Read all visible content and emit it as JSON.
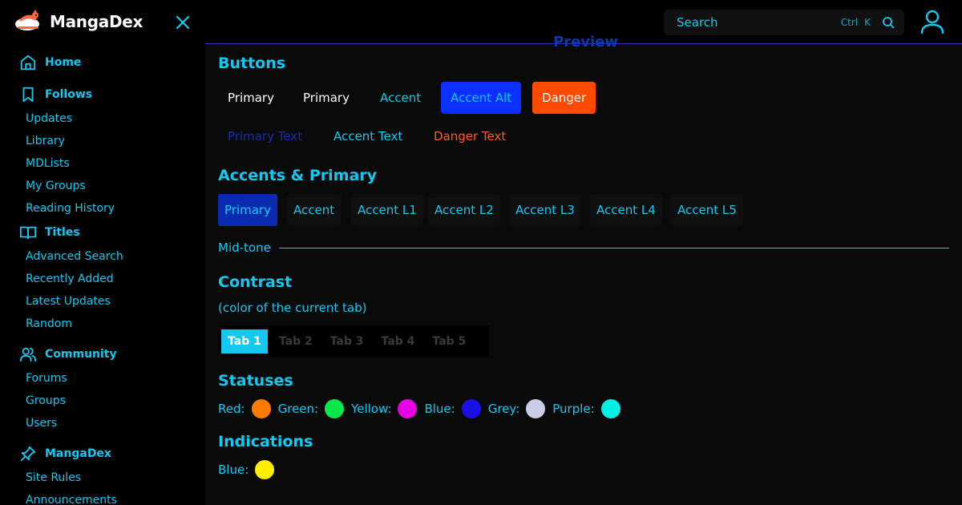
{
  "app": {
    "name": "MangaDex"
  },
  "topbar": {
    "search_placeholder": "Search",
    "shortcut_ctrl": "Ctrl",
    "shortcut_key": "K"
  },
  "sidebar": {
    "sections": [
      {
        "label": "Home",
        "icon": "home-icon",
        "items": []
      },
      {
        "label": "Follows",
        "icon": "bookmark-icon",
        "items": [
          "Updates",
          "Library",
          "MDLists",
          "My Groups",
          "Reading History"
        ]
      },
      {
        "label": "Titles",
        "icon": "book-icon",
        "items": [
          "Advanced Search",
          "Recently Added",
          "Latest Updates",
          "Random"
        ]
      },
      {
        "label": "Community",
        "icon": "users-icon",
        "items": [
          "Forums",
          "Groups",
          "Users"
        ]
      },
      {
        "label": "MangaDex",
        "icon": "pin-icon",
        "items": [
          "Site Rules",
          "Announcements"
        ]
      }
    ]
  },
  "main": {
    "peek_heading": "Preview",
    "buttons_heading": "Buttons",
    "buttons": [
      "Primary",
      "Primary",
      "Accent",
      "Accent Alt",
      "Danger"
    ],
    "text_buttons": [
      "Primary Text",
      "Accent Text",
      "Danger Text"
    ],
    "accents_heading": "Accents & Primary",
    "accent_tiles": [
      "Primary",
      "Accent",
      "Accent L1",
      "Accent L2",
      "Accent L3",
      "Accent L4",
      "Accent L5"
    ],
    "midtone_label": "Mid-tone",
    "contrast_heading": "Contrast",
    "contrast_sub": "(color of the current tab)",
    "tabs": [
      "Tab 1",
      "Tab 2",
      "Tab 3",
      "Tab 4",
      "Tab 5"
    ],
    "statuses_heading": "Statuses",
    "statuses": [
      {
        "label": "Red:",
        "color": "#ff7b00"
      },
      {
        "label": "Green:",
        "color": "#08e84a"
      },
      {
        "label": "Yellow:",
        "color": "#e600e6"
      },
      {
        "label": "Blue:",
        "color": "#1a10e6"
      },
      {
        "label": "Grey:",
        "color": "#c9cde6"
      },
      {
        "label": "Purple:",
        "color": "#00f0e6"
      }
    ],
    "indications_heading": "Indications",
    "indications": [
      {
        "label": "Blue:",
        "color": "#ffee00"
      }
    ]
  },
  "colors": {
    "accent": "#14c8f0",
    "primary": "#0a2ab0",
    "accent_alt": "#0b2fff",
    "danger": "#ff4a00",
    "primary_text": "#1a2ab0",
    "danger_text": "#ff5a1a"
  }
}
